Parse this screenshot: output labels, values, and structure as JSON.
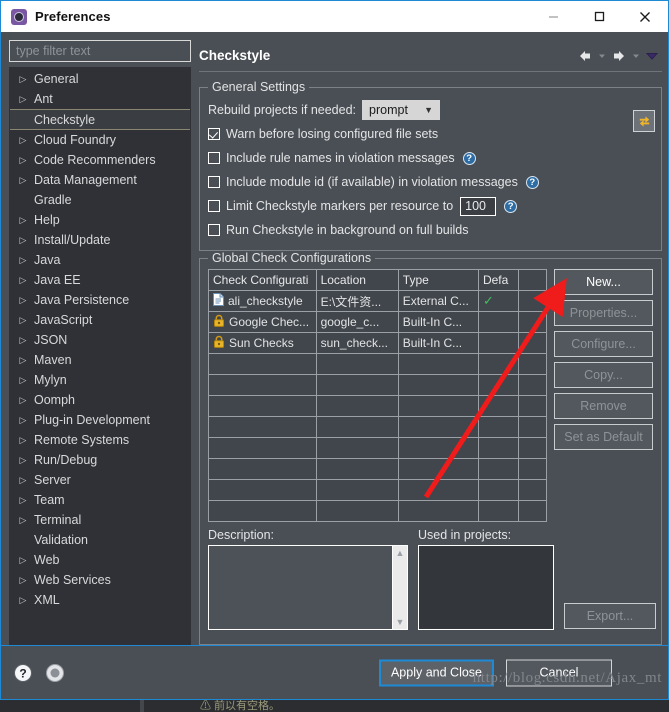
{
  "window": {
    "title": "Preferences",
    "icon": "preferences-gear-icon",
    "controls": {
      "minimize": "minimize-icon",
      "maximize": "maximize-icon",
      "close": "close-icon"
    }
  },
  "sidebar": {
    "filter": {
      "placeholder": "type filter text",
      "value": ""
    },
    "items": [
      {
        "label": "General",
        "expandable": true,
        "selected": false
      },
      {
        "label": "Ant",
        "expandable": true,
        "selected": false
      },
      {
        "label": "Checkstyle",
        "expandable": false,
        "selected": true
      },
      {
        "label": "Cloud Foundry",
        "expandable": true,
        "selected": false
      },
      {
        "label": "Code Recommenders",
        "expandable": true,
        "selected": false
      },
      {
        "label": "Data Management",
        "expandable": true,
        "selected": false
      },
      {
        "label": "Gradle",
        "expandable": false,
        "selected": false
      },
      {
        "label": "Help",
        "expandable": true,
        "selected": false
      },
      {
        "label": "Install/Update",
        "expandable": true,
        "selected": false
      },
      {
        "label": "Java",
        "expandable": true,
        "selected": false
      },
      {
        "label": "Java EE",
        "expandable": true,
        "selected": false
      },
      {
        "label": "Java Persistence",
        "expandable": true,
        "selected": false
      },
      {
        "label": "JavaScript",
        "expandable": true,
        "selected": false
      },
      {
        "label": "JSON",
        "expandable": true,
        "selected": false
      },
      {
        "label": "Maven",
        "expandable": true,
        "selected": false
      },
      {
        "label": "Mylyn",
        "expandable": true,
        "selected": false
      },
      {
        "label": "Oomph",
        "expandable": true,
        "selected": false
      },
      {
        "label": "Plug-in Development",
        "expandable": true,
        "selected": false
      },
      {
        "label": "Remote Systems",
        "expandable": true,
        "selected": false
      },
      {
        "label": "Run/Debug",
        "expandable": true,
        "selected": false
      },
      {
        "label": "Server",
        "expandable": true,
        "selected": false
      },
      {
        "label": "Team",
        "expandable": true,
        "selected": false
      },
      {
        "label": "Terminal",
        "expandable": true,
        "selected": false
      },
      {
        "label": "Validation",
        "expandable": false,
        "selected": false
      },
      {
        "label": "Web",
        "expandable": true,
        "selected": false
      },
      {
        "label": "Web Services",
        "expandable": true,
        "selected": false
      },
      {
        "label": "XML",
        "expandable": true,
        "selected": false
      }
    ]
  },
  "page": {
    "title": "Checkstyle",
    "nav": {
      "back": "back-arrow-icon",
      "back_menu": "back-dropdown-icon",
      "forward": "forward-arrow-icon",
      "forward_menu": "forward-dropdown-icon",
      "menu": "page-menu-icon"
    }
  },
  "general_settings": {
    "title": "General Settings",
    "rebuild_label": "Rebuild projects if needed:",
    "rebuild_value": "prompt",
    "refresh_icon": "refresh-sync-icon",
    "checkboxes": [
      {
        "label": "Warn before losing configured file sets",
        "checked": true,
        "help": false
      },
      {
        "label": "Include rule names in violation messages",
        "checked": false,
        "help": true
      },
      {
        "label": "Include module id (if available) in violation messages",
        "checked": false,
        "help": true
      },
      {
        "label": "Run Checkstyle in background on full builds",
        "checked": false,
        "help": false
      }
    ],
    "limit": {
      "label": "Limit Checkstyle markers per resource to",
      "checked": false,
      "value": "100",
      "help": true
    }
  },
  "global_configs": {
    "title": "Global Check Configurations",
    "columns": [
      "Check Configurati",
      "Location",
      "Type",
      "Defa",
      ""
    ],
    "rows": [
      {
        "icon": "document-icon",
        "name": "ali_checkstyle",
        "location": "E:\\文件资...",
        "type": "External C...",
        "default": true
      },
      {
        "icon": "lock-icon",
        "name": "Google Chec...",
        "location": "google_c...",
        "type": "Built-In C...",
        "default": false
      },
      {
        "icon": "lock-icon",
        "name": "Sun Checks",
        "location": "sun_check...",
        "type": "Built-In C...",
        "default": false
      }
    ],
    "empty_row_count": 8,
    "buttons": [
      {
        "label": "New...",
        "enabled": true
      },
      {
        "label": "Properties...",
        "enabled": false
      },
      {
        "label": "Configure...",
        "enabled": false
      },
      {
        "label": "Copy...",
        "enabled": false
      },
      {
        "label": "Remove",
        "enabled": false
      },
      {
        "label": "Set as Default",
        "enabled": false
      }
    ],
    "description_label": "Description:",
    "description_value": "",
    "used_in_projects_label": "Used in projects:",
    "export_label": "Export..."
  },
  "footer": {
    "help_icon": "help-question-icon",
    "settings_icon": "apply-settings-icon",
    "apply_and_close": "Apply and Close",
    "cancel": "Cancel"
  },
  "watermark": "http://blog.csdn.net/Ajax_mt",
  "background": {
    "text": "⚠ 前以有空格。"
  },
  "colors": {
    "accent": "#1e8ad6",
    "dialog_bg": "#4a4f55",
    "tree_bg": "#2f3136",
    "titlebar_bg": "#ffffff",
    "annotation_arrow": "#f01b1b",
    "tick_green": "#3fbf5c",
    "lock_gold": "#e8b429"
  }
}
